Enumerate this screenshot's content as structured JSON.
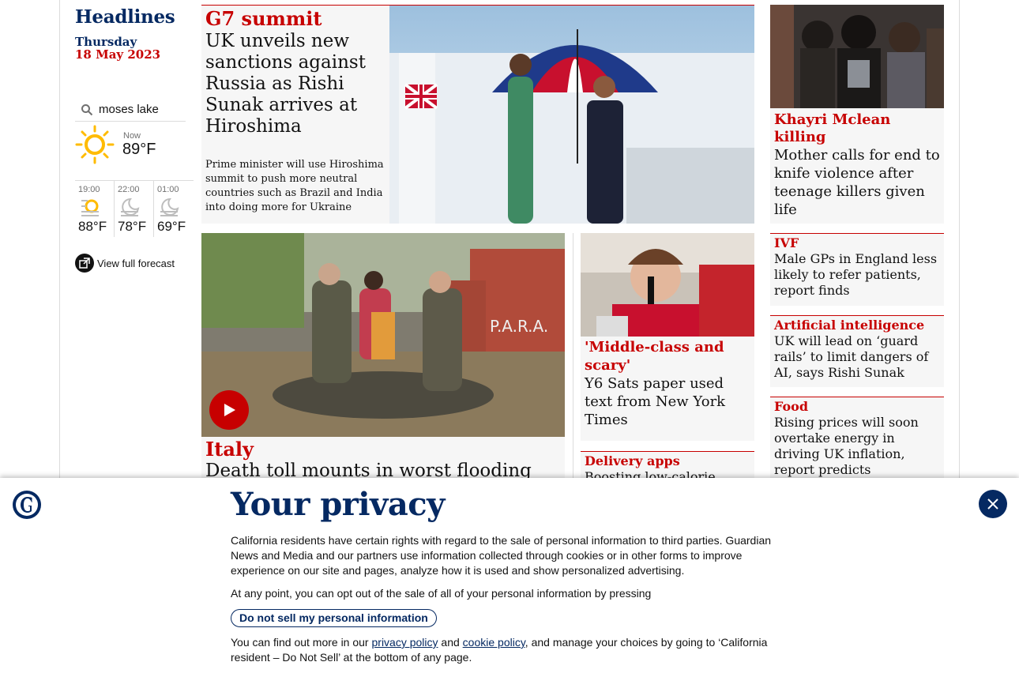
{
  "headlines": {
    "title": "Headlines",
    "day": "Thursday",
    "date": "18 May 2023"
  },
  "weather": {
    "location": "moses lake",
    "now_label": "Now",
    "now_temp": "89°F",
    "forecast": [
      {
        "time": "19:00",
        "temp": "88°F",
        "icon": "sun-haze-icon"
      },
      {
        "time": "22:00",
        "temp": "78°F",
        "icon": "moon-haze-icon"
      },
      {
        "time": "01:00",
        "temp": "69°F",
        "icon": "moon-haze-icon"
      }
    ],
    "full_forecast_label": "View full forecast"
  },
  "cards": {
    "main": {
      "kicker": "G7 summit",
      "headline": "UK unveils new sanctions against Russia as Rishi Sunak arrives at Hiroshima",
      "standfirst": "Prime minister will use Hiroshima summit to push more neutral countries such as Brazil and India into doing more for Ukraine"
    },
    "right1": {
      "kicker": "Khayri Mclean killing",
      "headline": "Mother calls for end to knife violence after teenage killers given life"
    },
    "italy": {
      "kicker": "Italy",
      "headline": "Death toll mounts in worst flooding for"
    },
    "sats": {
      "kicker": "'Middle-class and scary'",
      "headline": "Y6 Sats paper used text from New York Times"
    },
    "delivery": {
      "kicker": "Delivery apps",
      "headline": "Boosting low-calorie"
    },
    "ivf": {
      "kicker": "IVF",
      "headline": "Male GPs in England less likely to refer patients, report finds"
    },
    "ai": {
      "kicker": "Artificial intelligence",
      "headline": "UK will lead on ‘guard rails’ to limit dangers of AI, says Rishi Sunak"
    },
    "food": {
      "kicker": "Food",
      "headline": "Rising prices will soon overtake energy in driving UK inflation, report predicts"
    }
  },
  "privacy": {
    "title": "Your privacy",
    "para1": "California residents have certain rights with regard to the sale of personal information to third parties. Guardian News and Media and our partners use information collected through cookies or in other forms to improve experience on our site and pages, analyze how it is used and show personalized advertising.",
    "para2": "At any point, you can opt out of the sale of all of your personal information by pressing",
    "dns_button": "Do not sell my personal information",
    "para3_start": "You can find out more in our",
    "privacy_link": "privacy policy",
    "and": "and",
    "cookie_link": "cookie policy",
    "para3_end": ", and manage your choices by going to ‘California resident – Do Not Sell’ at the bottom of any page."
  },
  "colors": {
    "brand": "#052962",
    "accent": "#c70000",
    "card_bg": "#f6f6f6"
  }
}
